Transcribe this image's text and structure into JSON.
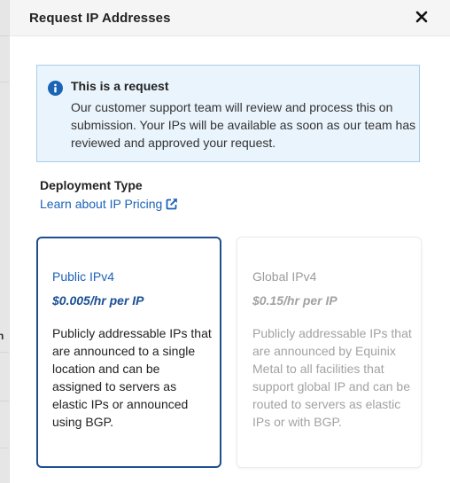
{
  "background": {
    "partial_char": "n"
  },
  "modal": {
    "title": "Request IP Addresses"
  },
  "info": {
    "icon": "info-icon",
    "title": "This is a request",
    "text": "Our customer support team will review and process this on submission. Your IPs will be available as soon as our team has reviewed and approved your request."
  },
  "deployment": {
    "label": "Deployment Type",
    "link_text": "Learn about IP Pricing",
    "link_icon": "external-link-icon"
  },
  "options": [
    {
      "name": "Public IPv4",
      "price": "$0.005/hr per IP",
      "description": "Publicly addressable IPs that are announced to a single location and can be assigned to servers as elastic IPs or announced using BGP.",
      "selected": true
    },
    {
      "name": "Global IPv4",
      "price": "$0.15/hr per IP",
      "description": "Publicly addressable IPs that are announced by Equinix Metal to all facilities that support global IP and can be routed to servers as elastic IPs or with BGP.",
      "selected": false
    }
  ],
  "colors": {
    "accent": "#1c63b7",
    "selected_border": "#1f4f8f",
    "info_bg": "#eaf4fc",
    "info_border": "#a9cde8",
    "disabled_text": "#a2a2a2"
  }
}
